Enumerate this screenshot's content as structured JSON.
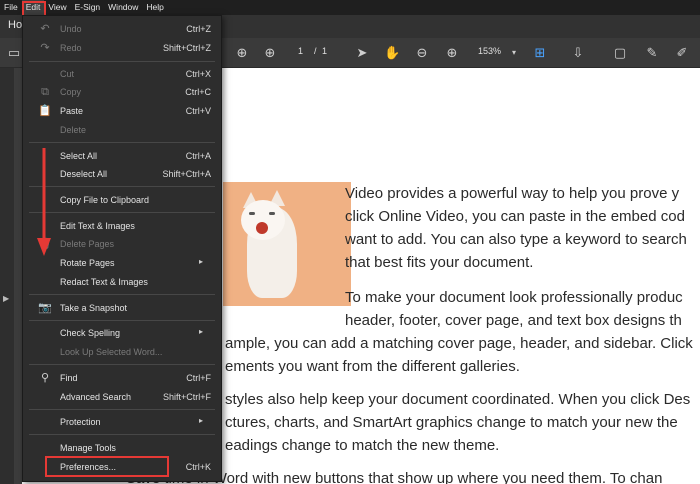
{
  "menubar": {
    "items": [
      "File",
      "Edit",
      "View",
      "E-Sign",
      "Window",
      "Help"
    ]
  },
  "tabbar": {
    "tab_label": "Ho"
  },
  "toolbar": {
    "page_current": "1",
    "page_separator": "/",
    "page_total": "1",
    "zoom": "153%"
  },
  "edit_menu": {
    "undo": {
      "label": "Undo",
      "shortcut": "Ctrl+Z"
    },
    "redo": {
      "label": "Redo",
      "shortcut": "Shift+Ctrl+Z"
    },
    "cut": {
      "label": "Cut",
      "shortcut": "Ctrl+X"
    },
    "copy": {
      "label": "Copy",
      "shortcut": "Ctrl+C"
    },
    "paste": {
      "label": "Paste",
      "shortcut": "Ctrl+V"
    },
    "delete": {
      "label": "Delete"
    },
    "select_all": {
      "label": "Select All",
      "shortcut": "Ctrl+A"
    },
    "deselect_all": {
      "label": "Deselect All",
      "shortcut": "Shift+Ctrl+A"
    },
    "copy_file": {
      "label": "Copy File to Clipboard"
    },
    "edit_text": {
      "label": "Edit Text & Images"
    },
    "delete_pages": {
      "label": "Delete Pages"
    },
    "rotate_pages": {
      "label": "Rotate Pages"
    },
    "redact": {
      "label": "Redact Text & Images"
    },
    "snapshot": {
      "label": "Take a Snapshot"
    },
    "check_spelling": {
      "label": "Check Spelling"
    },
    "lookup": {
      "label": "Look Up Selected Word..."
    },
    "find": {
      "label": "Find",
      "shortcut": "Ctrl+F"
    },
    "advanced_search": {
      "label": "Advanced Search",
      "shortcut": "Shift+Ctrl+F"
    },
    "protection": {
      "label": "Protection"
    },
    "manage_tools": {
      "label": "Manage Tools"
    },
    "preferences": {
      "label": "Preferences...",
      "shortcut": "Ctrl+K"
    }
  },
  "document": {
    "lines": [
      "Video provides a powerful way to help you prove y",
      "click Online Video, you can paste in the embed cod",
      "want to add. You can also type a keyword to search",
      "that best fits your document.",
      "To make your document look professionally produc",
      "header, footer, cover page, and text box designs th",
      "ample, you can add a matching cover page, header, and sidebar. Click",
      "ements you want from the different galleries.",
      "styles also help keep your document coordinated. When you click Des",
      "ctures, charts, and SmartArt graphics change to match your new the",
      "eadings change to match the new theme.",
      "Save time in Word with new buttons that show up where you need them. To chan"
    ]
  },
  "colors": {
    "highlight": "#e53935",
    "accent": "#4aa3ff",
    "menu_bg": "#2d2d2d"
  }
}
